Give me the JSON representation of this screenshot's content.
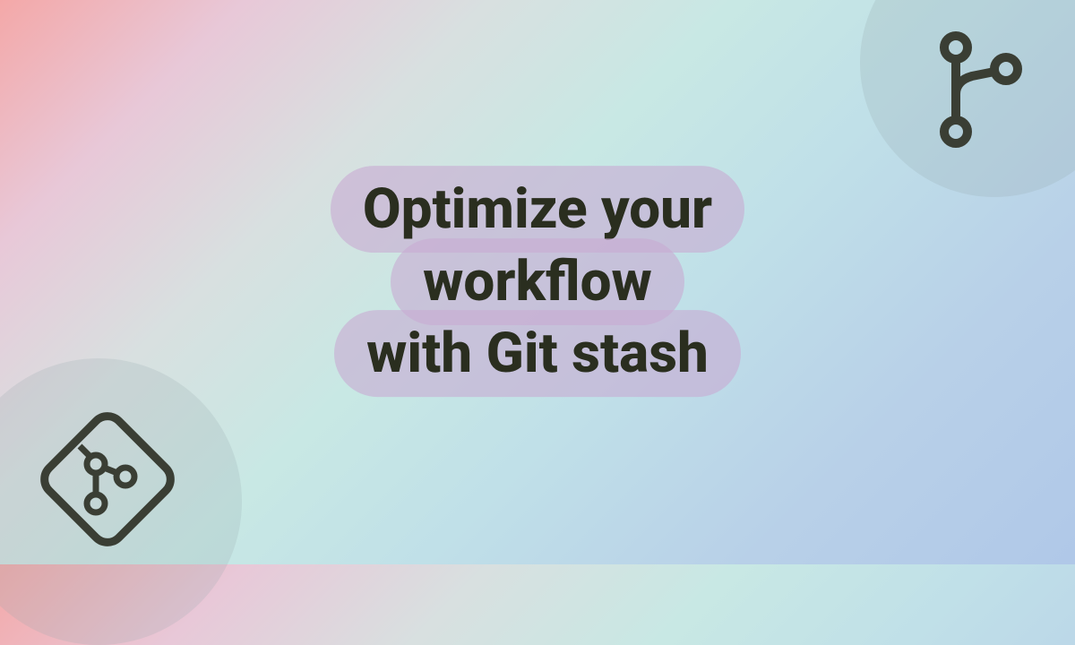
{
  "title": {
    "line1": "Optimize your workflow",
    "line2": "with Git stash"
  },
  "colors": {
    "iconColor": "#3a3e34",
    "textColor": "#2a2e1f",
    "highlightBg": "rgba(200, 170, 210, 0.6)"
  },
  "icons": {
    "topRight": "git-branch-icon",
    "bottomLeft": "git-logo-icon"
  }
}
